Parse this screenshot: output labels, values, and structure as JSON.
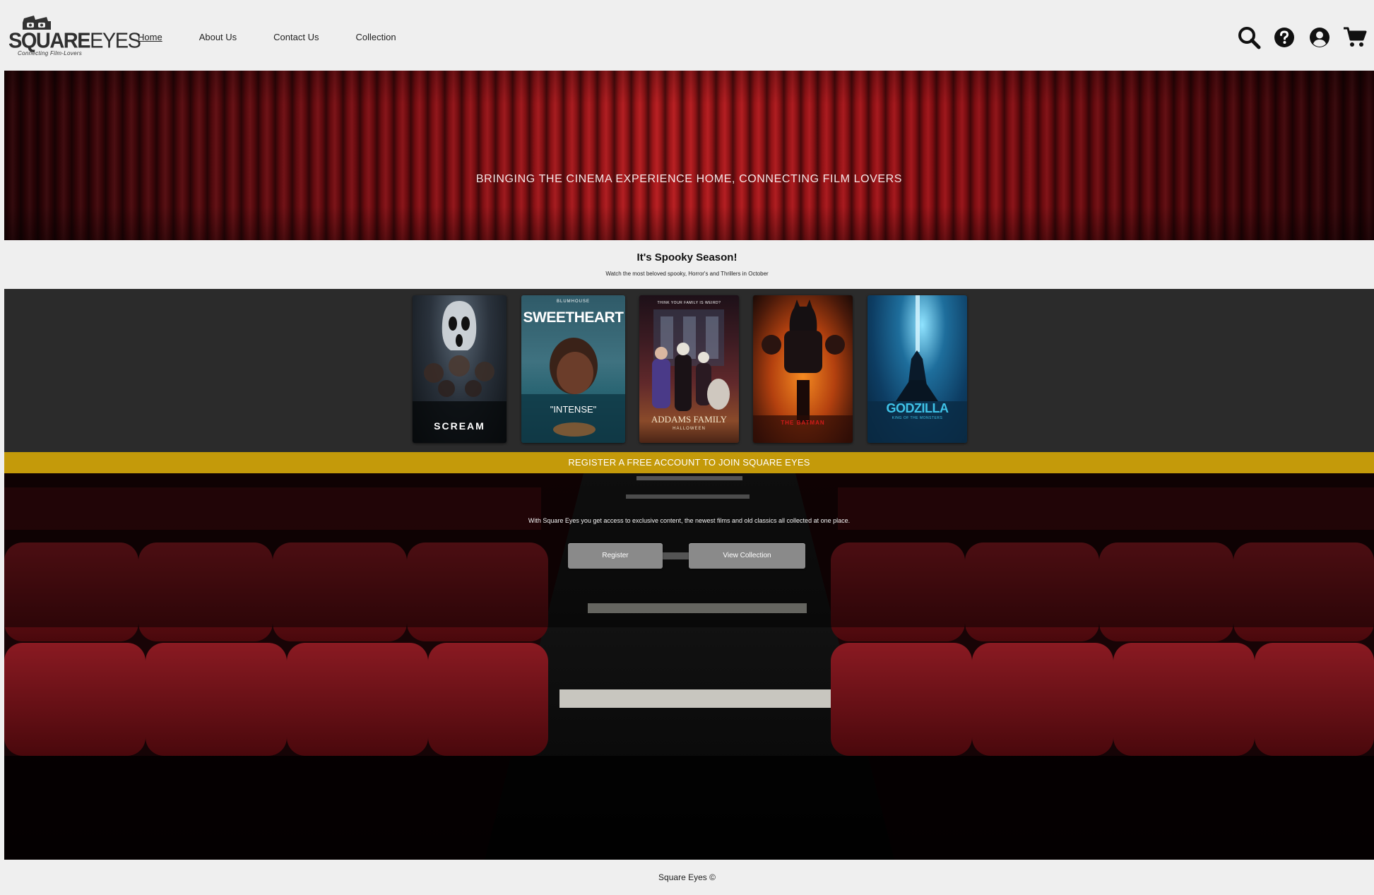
{
  "logo": {
    "word_bold": "SQUARE",
    "word_thin": "EYES",
    "tagline": "Connecting Film-Lovers"
  },
  "nav": [
    {
      "label": "Home",
      "active": true
    },
    {
      "label": "About Us",
      "active": false
    },
    {
      "label": "Contact Us",
      "active": false
    },
    {
      "label": "Collection",
      "active": false
    }
  ],
  "tools": [
    "search-icon",
    "help-icon",
    "account-icon",
    "cart-icon"
  ],
  "hero": {
    "text": "BRINGING THE CINEMA EXPERIENCE HOME, CONNECTING FILM LOVERS"
  },
  "spooky": {
    "title": "It's Spooky Season!",
    "subtitle": "Watch the most beloved spooky, Horror's and Thrillers in October"
  },
  "posters": [
    {
      "title": "SCREAM"
    },
    {
      "title": "SWEETHEART",
      "top": "BLUMHOUSE",
      "quote": "\"INTENSE\""
    },
    {
      "title": "ADDAMS FAMILY",
      "top": "THINK YOUR FAMILY IS WEIRD?",
      "sub": "HALLOWEEN"
    },
    {
      "title": "THE BATMAN"
    },
    {
      "title": "GODZILLA",
      "sub": "KING OF THE MONSTERS"
    }
  ],
  "register": {
    "banner": "REGISTER A FREE ACCOUNT TO JOIN SQUARE EYES",
    "text": "With Square Eyes you get access to exclusive content, the newest films and old classics all collected at one place.",
    "register_label": "Register",
    "collection_label": "View Collection"
  },
  "footer": {
    "text": "Square Eyes ©"
  },
  "colors": {
    "accent_gold": "#c49a0a",
    "curtain_red": "#b81a1d",
    "strip_dark": "#2b2b2b",
    "button_grey": "#8a8a8a"
  }
}
